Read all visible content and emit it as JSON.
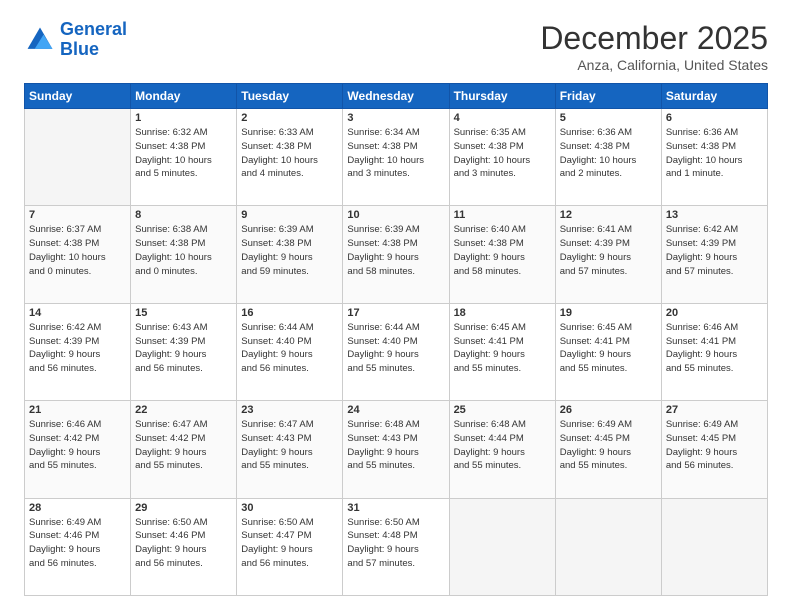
{
  "header": {
    "logo_line1": "General",
    "logo_line2": "Blue",
    "main_title": "December 2025",
    "sub_title": "Anza, California, United States"
  },
  "calendar": {
    "days_of_week": [
      "Sunday",
      "Monday",
      "Tuesday",
      "Wednesday",
      "Thursday",
      "Friday",
      "Saturday"
    ],
    "rows": [
      [
        {
          "day": "",
          "empty": true,
          "info": ""
        },
        {
          "day": "1",
          "info": "Sunrise: 6:32 AM\nSunset: 4:38 PM\nDaylight: 10 hours\nand 5 minutes."
        },
        {
          "day": "2",
          "info": "Sunrise: 6:33 AM\nSunset: 4:38 PM\nDaylight: 10 hours\nand 4 minutes."
        },
        {
          "day": "3",
          "info": "Sunrise: 6:34 AM\nSunset: 4:38 PM\nDaylight: 10 hours\nand 3 minutes."
        },
        {
          "day": "4",
          "info": "Sunrise: 6:35 AM\nSunset: 4:38 PM\nDaylight: 10 hours\nand 3 minutes."
        },
        {
          "day": "5",
          "info": "Sunrise: 6:36 AM\nSunset: 4:38 PM\nDaylight: 10 hours\nand 2 minutes."
        },
        {
          "day": "6",
          "info": "Sunrise: 6:36 AM\nSunset: 4:38 PM\nDaylight: 10 hours\nand 1 minute."
        }
      ],
      [
        {
          "day": "7",
          "info": "Sunrise: 6:37 AM\nSunset: 4:38 PM\nDaylight: 10 hours\nand 0 minutes."
        },
        {
          "day": "8",
          "info": "Sunrise: 6:38 AM\nSunset: 4:38 PM\nDaylight: 10 hours\nand 0 minutes."
        },
        {
          "day": "9",
          "info": "Sunrise: 6:39 AM\nSunset: 4:38 PM\nDaylight: 9 hours\nand 59 minutes."
        },
        {
          "day": "10",
          "info": "Sunrise: 6:39 AM\nSunset: 4:38 PM\nDaylight: 9 hours\nand 58 minutes."
        },
        {
          "day": "11",
          "info": "Sunrise: 6:40 AM\nSunset: 4:38 PM\nDaylight: 9 hours\nand 58 minutes."
        },
        {
          "day": "12",
          "info": "Sunrise: 6:41 AM\nSunset: 4:39 PM\nDaylight: 9 hours\nand 57 minutes."
        },
        {
          "day": "13",
          "info": "Sunrise: 6:42 AM\nSunset: 4:39 PM\nDaylight: 9 hours\nand 57 minutes."
        }
      ],
      [
        {
          "day": "14",
          "info": "Sunrise: 6:42 AM\nSunset: 4:39 PM\nDaylight: 9 hours\nand 56 minutes."
        },
        {
          "day": "15",
          "info": "Sunrise: 6:43 AM\nSunset: 4:39 PM\nDaylight: 9 hours\nand 56 minutes."
        },
        {
          "day": "16",
          "info": "Sunrise: 6:44 AM\nSunset: 4:40 PM\nDaylight: 9 hours\nand 56 minutes."
        },
        {
          "day": "17",
          "info": "Sunrise: 6:44 AM\nSunset: 4:40 PM\nDaylight: 9 hours\nand 55 minutes."
        },
        {
          "day": "18",
          "info": "Sunrise: 6:45 AM\nSunset: 4:41 PM\nDaylight: 9 hours\nand 55 minutes."
        },
        {
          "day": "19",
          "info": "Sunrise: 6:45 AM\nSunset: 4:41 PM\nDaylight: 9 hours\nand 55 minutes."
        },
        {
          "day": "20",
          "info": "Sunrise: 6:46 AM\nSunset: 4:41 PM\nDaylight: 9 hours\nand 55 minutes."
        }
      ],
      [
        {
          "day": "21",
          "info": "Sunrise: 6:46 AM\nSunset: 4:42 PM\nDaylight: 9 hours\nand 55 minutes."
        },
        {
          "day": "22",
          "info": "Sunrise: 6:47 AM\nSunset: 4:42 PM\nDaylight: 9 hours\nand 55 minutes."
        },
        {
          "day": "23",
          "info": "Sunrise: 6:47 AM\nSunset: 4:43 PM\nDaylight: 9 hours\nand 55 minutes."
        },
        {
          "day": "24",
          "info": "Sunrise: 6:48 AM\nSunset: 4:43 PM\nDaylight: 9 hours\nand 55 minutes."
        },
        {
          "day": "25",
          "info": "Sunrise: 6:48 AM\nSunset: 4:44 PM\nDaylight: 9 hours\nand 55 minutes."
        },
        {
          "day": "26",
          "info": "Sunrise: 6:49 AM\nSunset: 4:45 PM\nDaylight: 9 hours\nand 55 minutes."
        },
        {
          "day": "27",
          "info": "Sunrise: 6:49 AM\nSunset: 4:45 PM\nDaylight: 9 hours\nand 56 minutes."
        }
      ],
      [
        {
          "day": "28",
          "info": "Sunrise: 6:49 AM\nSunset: 4:46 PM\nDaylight: 9 hours\nand 56 minutes."
        },
        {
          "day": "29",
          "info": "Sunrise: 6:50 AM\nSunset: 4:46 PM\nDaylight: 9 hours\nand 56 minutes."
        },
        {
          "day": "30",
          "info": "Sunrise: 6:50 AM\nSunset: 4:47 PM\nDaylight: 9 hours\nand 56 minutes."
        },
        {
          "day": "31",
          "info": "Sunrise: 6:50 AM\nSunset: 4:48 PM\nDaylight: 9 hours\nand 57 minutes."
        },
        {
          "day": "",
          "empty": true,
          "info": ""
        },
        {
          "day": "",
          "empty": true,
          "info": ""
        },
        {
          "day": "",
          "empty": true,
          "info": ""
        }
      ]
    ]
  }
}
